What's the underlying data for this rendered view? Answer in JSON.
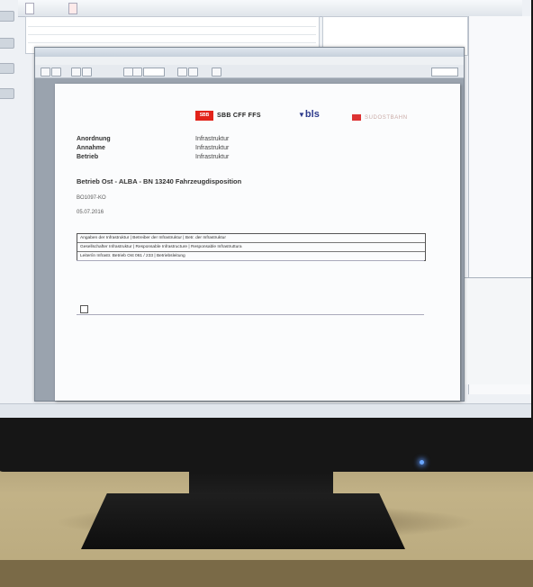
{
  "monitor_screen": {
    "app_tabs": [
      "",
      ""
    ],
    "side_panel_items": [
      "",
      "",
      "",
      ""
    ],
    "taskbar_text": ""
  },
  "viewer": {
    "title": "",
    "menu": [],
    "page_number": "",
    "zoom": ""
  },
  "document": {
    "logos": {
      "sbb_mark": "SBB",
      "sbb_text": "SBB CFF FFS",
      "bls_text": "bls",
      "ssb_text": "SUDOSTBAHN"
    },
    "fields": [
      {
        "label": "Anordnung",
        "value": "Infrastruktur"
      },
      {
        "label": "Annahme",
        "value": "Infrastruktur"
      },
      {
        "label": "Betrieb",
        "value": "Infrastruktur"
      }
    ],
    "heading": "Betrieb Ost - ALBA - BN 13240 Fahrzeugdisposition",
    "ref_code": "BO1097-KO",
    "date": "05.07.2016",
    "table_rows": [
      "Angaben der Infrastruktur | Betreiber der Infrastruktur | Betr. der Infrastruktur",
      "Gesellschafter Infrastruktur | Responsable Infrastructure | Responsable Infrastruttura",
      "Leiter/in Infrastr. Betrieb Ost 061 / 233 | Betriebsleitung"
    ],
    "items": [
      {
        "line1": "",
        "line2": ""
      },
      {
        "line1": "",
        "line2": ""
      }
    ]
  }
}
